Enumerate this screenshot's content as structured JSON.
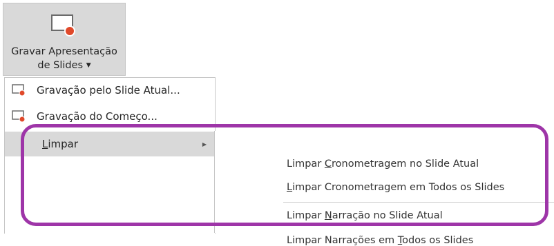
{
  "ribbon": {
    "button_line1": "Gravar Apresentação",
    "button_line2": "de Slides",
    "icon": "record-slideshow-icon"
  },
  "menu": {
    "items": [
      {
        "label": "Gravação pelo Slide Atual...",
        "icon": "record-from-current-icon"
      },
      {
        "label": "Gravação do Começo...",
        "icon": "record-from-beginning-icon"
      },
      {
        "label_prefix": "",
        "label_accel": "L",
        "label_rest": "impar",
        "icon": "submenu-arrow-icon"
      }
    ]
  },
  "submenu": {
    "items": [
      {
        "prefix": "Limpar ",
        "accel": "C",
        "rest": "ronometragem no Slide Atual"
      },
      {
        "prefix": "",
        "accel": "L",
        "rest": "impar Cronometragem em Todos os Slides"
      },
      {
        "prefix": "Limpar ",
        "accel": "N",
        "rest": "arração no Slide Atual"
      },
      {
        "prefix": "Limpar Narrações em ",
        "accel": "T",
        "rest": "odos os Slides"
      }
    ]
  },
  "colors": {
    "highlight": "#9e35a8",
    "ribbon_bg": "#d9d9d9",
    "record_dot": "#e0492a"
  }
}
